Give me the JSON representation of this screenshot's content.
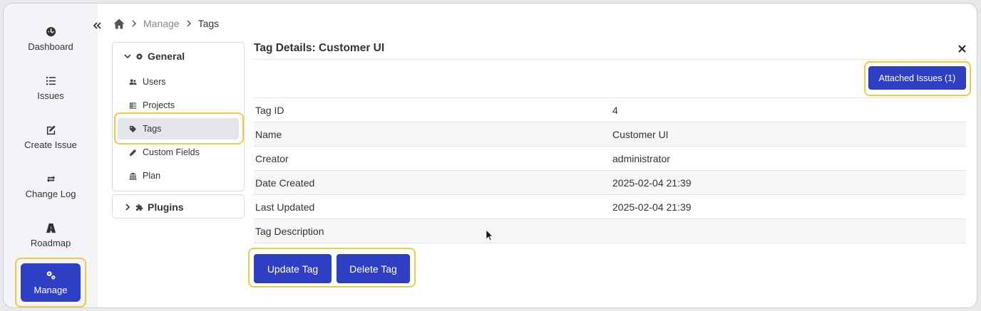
{
  "nav": {
    "items": [
      {
        "label": "Dashboard",
        "icon": "dashboard-icon"
      },
      {
        "label": "Issues",
        "icon": "list-icon"
      },
      {
        "label": "Create Issue",
        "icon": "edit-icon"
      },
      {
        "label": "Change Log",
        "icon": "change-log-icon"
      },
      {
        "label": "Roadmap",
        "icon": "roadmap-icon"
      },
      {
        "label": "Manage",
        "icon": "gears-icon",
        "active": true
      }
    ]
  },
  "breadcrumb": {
    "items": [
      "Manage",
      "Tags"
    ]
  },
  "submenu": {
    "general": {
      "label": "General",
      "items": [
        {
          "label": "Users",
          "icon": "users-icon"
        },
        {
          "label": "Projects",
          "icon": "projects-icon"
        },
        {
          "label": "Tags",
          "icon": "tag-icon",
          "active": true
        },
        {
          "label": "Custom Fields",
          "icon": "pencil-icon"
        },
        {
          "label": "Plan",
          "icon": "bank-icon"
        }
      ]
    },
    "plugins": {
      "label": "Plugins"
    }
  },
  "panel": {
    "title": "Tag Details: Customer UI",
    "attached_issues_label": "Attached Issues (1)",
    "fields": [
      {
        "label": "Tag ID",
        "value": "4"
      },
      {
        "label": "Name",
        "value": "Customer UI"
      },
      {
        "label": "Creator",
        "value": "administrator"
      },
      {
        "label": "Date Created",
        "value": "2025-02-04 21:39"
      },
      {
        "label": "Last Updated",
        "value": "2025-02-04 21:39"
      },
      {
        "label": "Tag Description",
        "value": ""
      }
    ],
    "update_label": "Update Tag",
    "delete_label": "Delete Tag"
  },
  "colors": {
    "accent": "#2f3fc4",
    "highlight": "#f0c94a"
  }
}
